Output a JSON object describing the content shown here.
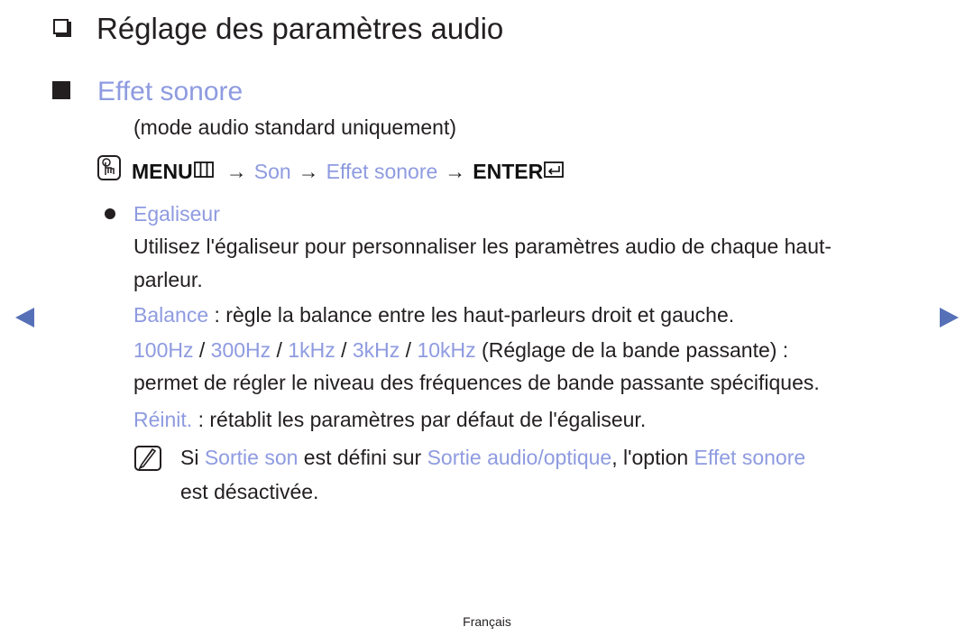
{
  "heading": {
    "icon": "hollow-checkbox-icon",
    "title": "Réglage des paramètres audio"
  },
  "section": {
    "icon": "filled-square-icon",
    "title": "Effet sonore",
    "subtitle": "(mode audio standard uniquement)"
  },
  "menu_path": {
    "icon": "touch-hand-icon",
    "menu_label": "MENU",
    "menu_icon": "menu-grid-icon",
    "arrow": "→",
    "steps": [
      "Son",
      "Effet sonore"
    ],
    "enter_label": "ENTER",
    "enter_icon": "enter-return-icon"
  },
  "egaliseur": {
    "title": "Egaliseur",
    "description_line1": "Utilisez l'égaliseur pour personnaliser les paramètres audio de chaque haut-",
    "description_line2": "parleur.",
    "balance": {
      "label": "Balance",
      "text": " : règle la balance entre les haut-parleurs droit et gauche."
    },
    "frequencies": {
      "items": [
        "100Hz",
        "300Hz",
        "1kHz",
        "3kHz",
        "10kHz"
      ],
      "separator": " / ",
      "suffix": " (Réglage de la bande passante) :",
      "line2": "permet de régler le niveau des fréquences de bande passante spécifiques."
    },
    "reinit": {
      "label": "Réinit.",
      "text": " : rétablit les paramètres par défaut de l'égaliseur."
    }
  },
  "note": {
    "icon": "note-pencil-icon",
    "part1": "Si ",
    "link1": "Sortie son",
    "part2": " est défini sur ",
    "link2": "Sortie audio/optique",
    "part3": ", l'option ",
    "link3": "Effet sonore",
    "line2": "est désactivée."
  },
  "navigation": {
    "prev_icon": "previous-page-arrow-icon",
    "next_icon": "next-page-arrow-icon"
  },
  "footer": {
    "language": "Français"
  },
  "colors": {
    "accent_link": "#8e9be0",
    "nav_arrow": "#5670b8",
    "text": "#231f20"
  }
}
